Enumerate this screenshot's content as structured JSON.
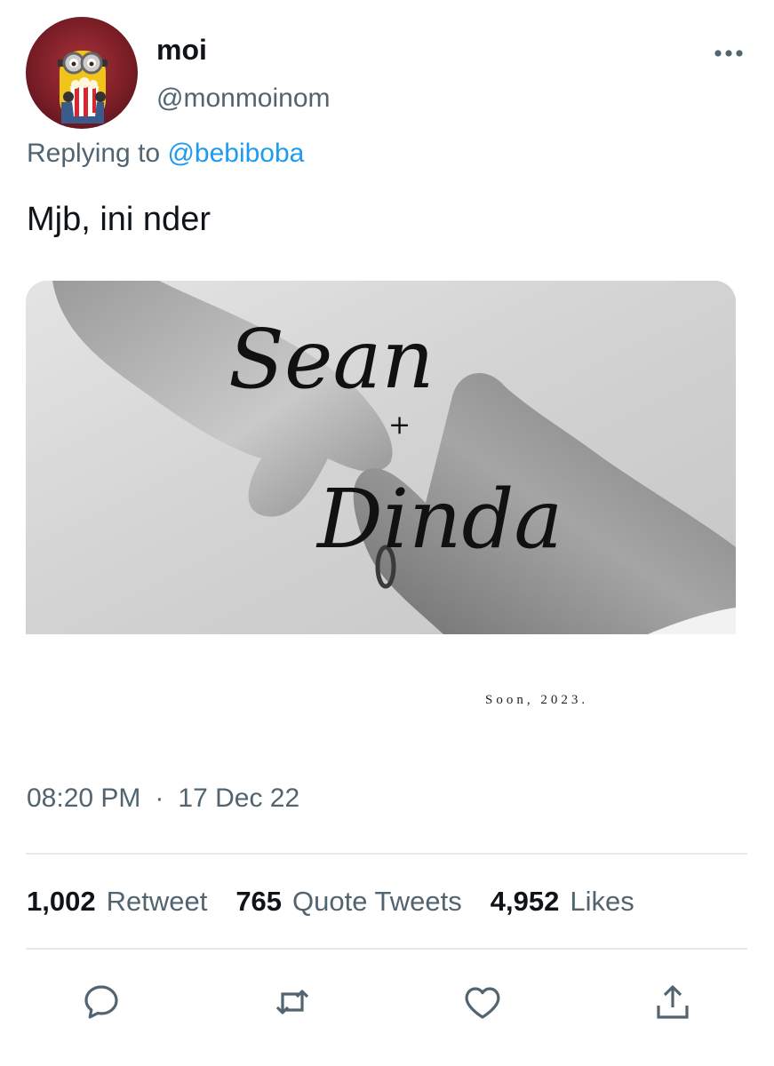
{
  "tweet": {
    "display_name": "moi",
    "handle": "@monmoinom",
    "replying_prefix": "Replying to",
    "replying_to": "@bebiboba",
    "text": "Mjb, ini nder",
    "media": {
      "script_line1": "Sean",
      "script_plus": "+",
      "script_line2": "Dinda",
      "caption": "Soon, 2023."
    },
    "time": "08:20 PM",
    "date": "17 Dec 22",
    "separator": "·"
  },
  "stats": {
    "retweets": "1,002",
    "retweets_label": "Retweet",
    "quotes": "765",
    "quotes_label": "Quote Tweets",
    "likes": "4,952",
    "likes_label": "Likes"
  },
  "colors": {
    "accent": "#1d9bf0",
    "secondary_text": "#536471",
    "primary_text": "#0f1419",
    "divider": "#e6e9ea"
  },
  "icons": {
    "more": "more-icon",
    "reply": "reply-icon",
    "retweet": "retweet-icon",
    "like": "heart-icon",
    "share": "share-icon"
  }
}
